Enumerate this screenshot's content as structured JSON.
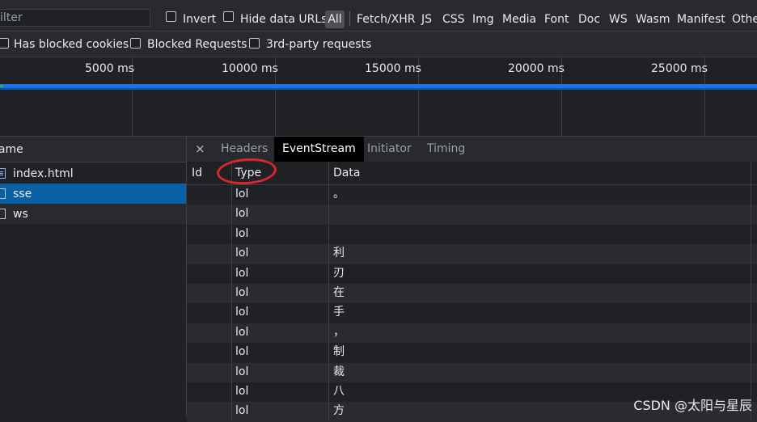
{
  "filter": {
    "placeholder": "Filter",
    "value": "ilter"
  },
  "toolbar": {
    "invert_label": "Invert",
    "hide_data_urls_label": "Hide data URLs",
    "all_label": "All",
    "types": [
      "Fetch/XHR",
      "JS",
      "CSS",
      "Img",
      "Media",
      "Font",
      "Doc",
      "WS",
      "Wasm",
      "Manifest",
      "Othe"
    ]
  },
  "toolbar2": {
    "has_blocked_cookies": "Has blocked cookies",
    "blocked_requests": "Blocked Requests",
    "third_party": "3rd-party requests"
  },
  "overview": {
    "ticks": [
      "5000 ms",
      "10000 ms",
      "15000 ms",
      "20000 ms",
      "25000 ms"
    ]
  },
  "requests": {
    "header": "Name",
    "header_visible": "lame",
    "items": [
      {
        "name": "index.html",
        "icon": "document-icon"
      },
      {
        "name": "sse",
        "icon": "file-icon"
      },
      {
        "name": "ws",
        "icon": "file-icon"
      }
    ]
  },
  "detail": {
    "close": "×",
    "tabs": [
      "Headers",
      "EventStream",
      "Initiator",
      "Timing"
    ],
    "active_tab": "EventStream",
    "columns": {
      "id": "Id",
      "type": "Type",
      "data": "Data"
    },
    "rows": [
      {
        "id": "",
        "type": "lol",
        "data": "。"
      },
      {
        "id": "",
        "type": "lol",
        "data": ""
      },
      {
        "id": "",
        "type": "lol",
        "data": ""
      },
      {
        "id": "",
        "type": "lol",
        "data": "利"
      },
      {
        "id": "",
        "type": "lol",
        "data": "刃"
      },
      {
        "id": "",
        "type": "lol",
        "data": "在"
      },
      {
        "id": "",
        "type": "lol",
        "data": "手"
      },
      {
        "id": "",
        "type": "lol",
        "data": "，"
      },
      {
        "id": "",
        "type": "lol",
        "data": "制"
      },
      {
        "id": "",
        "type": "lol",
        "data": "裁"
      },
      {
        "id": "",
        "type": "lol",
        "data": "八"
      },
      {
        "id": "",
        "type": "lol",
        "data": "方"
      }
    ]
  },
  "watermark": "CSDN @太阳与星辰",
  "colors": {
    "accent": "#1a73e8",
    "selected_row": "#0b5fa5",
    "annotation": "#d8262c"
  }
}
